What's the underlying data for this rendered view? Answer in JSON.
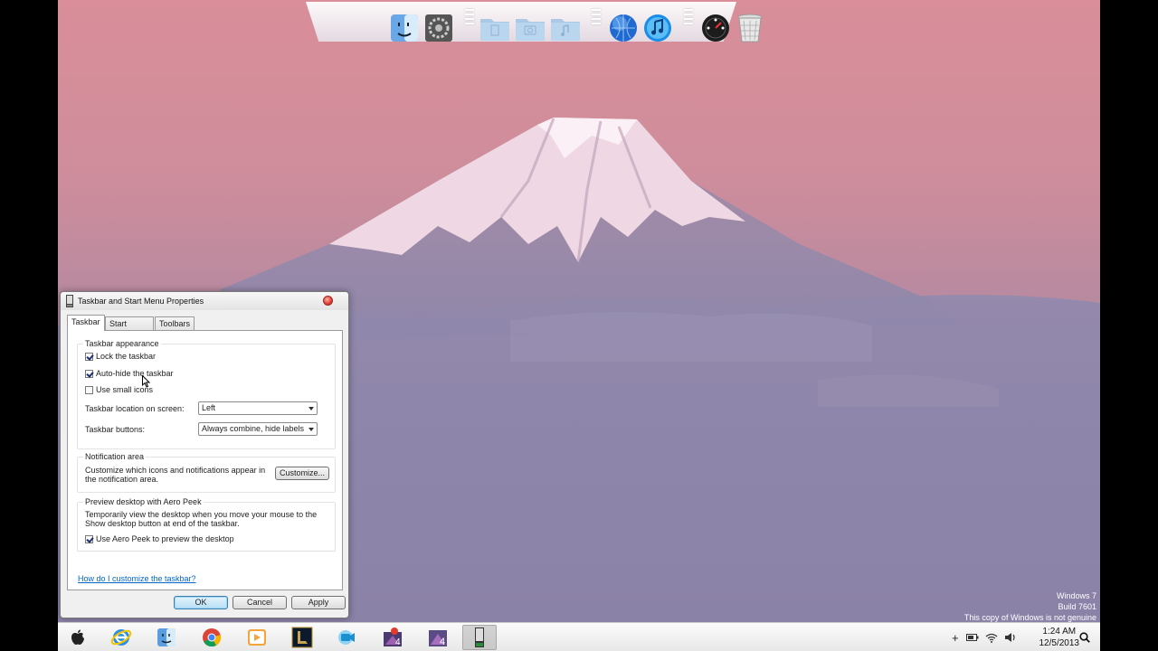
{
  "dock": {
    "icons": [
      "finder-icon",
      "system-preferences-icon",
      "documents-folder-icon",
      "pictures-folder-icon",
      "music-folder-icon",
      "globe-icon",
      "itunes-icon",
      "dashboard-icon",
      "trash-icon"
    ]
  },
  "dialog": {
    "title": "Taskbar and Start Menu Properties",
    "tabs": [
      "Taskbar",
      "Start Menu",
      "Toolbars"
    ],
    "appearance": {
      "group_title": "Taskbar appearance",
      "lock": "Lock the taskbar",
      "autohide": "Auto-hide the taskbar",
      "small_icons": "Use small icons",
      "location_label": "Taskbar location on screen:",
      "location_value": "Left",
      "buttons_label": "Taskbar buttons:",
      "buttons_value": "Always combine, hide labels"
    },
    "notification": {
      "group_title": "Notification area",
      "text": "Customize which icons and notifications appear in the notification area.",
      "customize": "Customize..."
    },
    "aero": {
      "group_title": "Preview desktop with Aero Peek",
      "text": "Temporarily view the desktop when you move your mouse to the Show desktop button at end of the taskbar.",
      "checkbox": "Use Aero Peek to preview the desktop"
    },
    "help_link": "How do I customize the taskbar?",
    "ok": "OK",
    "cancel": "Cancel",
    "apply": "Apply"
  },
  "taskbar": {
    "items": [
      "apple-icon",
      "internet-explorer-icon",
      "finder-icon",
      "chrome-icon",
      "media-player-icon",
      "league-of-legends-icon",
      "facetime-icon",
      "app-4-icon",
      "app-4b-icon",
      "taskbar-properties-icon"
    ],
    "tray_icons": [
      "plus-icon",
      "battery-icon",
      "wifi-icon",
      "volume-icon"
    ],
    "time": "1:24 AM",
    "date": "12/5/2013"
  },
  "watermark": {
    "line1": "Windows 7",
    "line2": "Build 7601",
    "line3": "This copy of Windows is not genuine"
  }
}
